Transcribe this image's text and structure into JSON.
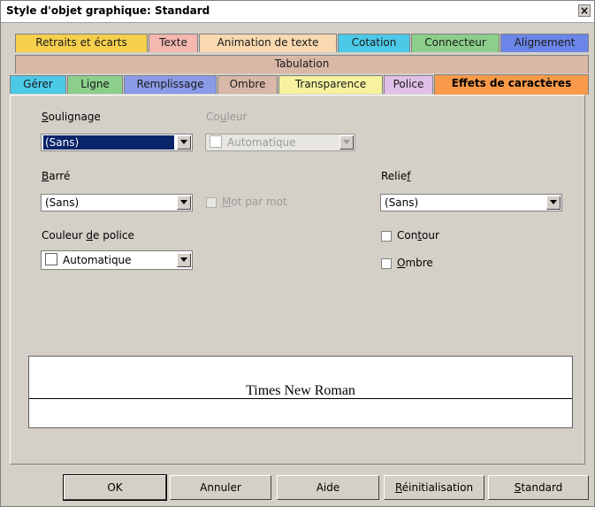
{
  "window": {
    "title": "Style d'objet graphique: Standard",
    "close_glyph": "×"
  },
  "tabs_row1": [
    {
      "label": "Retraits et écarts",
      "color": "#f6d04d"
    },
    {
      "label": "Texte",
      "color": "#f4b8b0"
    },
    {
      "label": "Animation de texte",
      "color": "#f9d9b0"
    },
    {
      "label": "Cotation",
      "color": "#4dc9e8"
    },
    {
      "label": "Connecteur",
      "color": "#8ccf8c"
    },
    {
      "label": "Alignement",
      "color": "#6b86e8"
    }
  ],
  "tabs_row2": [
    {
      "label": "Tabulation",
      "color": "#d9b8a8"
    }
  ],
  "tabs_row3": [
    {
      "label": "Gérer",
      "color": "#4dc9e8"
    },
    {
      "label": "Ligne",
      "color": "#8ccf8c"
    },
    {
      "label": "Remplissage",
      "color": "#8a9be8"
    },
    {
      "label": "Ombre",
      "color": "#d9b8a8"
    },
    {
      "label": "Transparence",
      "color": "#f6f2a0"
    },
    {
      "label": "Police",
      "color": "#e0c0e8"
    },
    {
      "label": "Effets de caractères",
      "color": "#f99a4a",
      "active": true
    }
  ],
  "form": {
    "soulignage": {
      "label_first": "S",
      "label_rest": "oulignage",
      "value": "(Sans)"
    },
    "couleur": {
      "label_pre": "Co",
      "label_u": "u",
      "label_post": "leur",
      "value": "Automatique"
    },
    "barre": {
      "label_first": "B",
      "label_rest": "arré",
      "value": "(Sans)"
    },
    "mot_par_mot": {
      "label_first": "M",
      "label_rest": "ot par mot"
    },
    "relief": {
      "label_pre": "Relie",
      "label_u": "f",
      "value": "(Sans)"
    },
    "couleur_police": {
      "label_pre": "Couleur ",
      "label_u": "d",
      "label_post": "e police",
      "value": "Automatique"
    },
    "contour": {
      "label_pre": "Con",
      "label_u": "t",
      "label_post": "our"
    },
    "ombre": {
      "label_first": "O",
      "label_rest": "mbre"
    }
  },
  "preview": {
    "text": "Times New Roman"
  },
  "buttons": {
    "ok": "OK",
    "annuler": "Annuler",
    "aide": "Aide",
    "reinit_first": "R",
    "reinit_rest": "éinitialisation",
    "standard_first": "S",
    "standard_rest": "tandard"
  }
}
